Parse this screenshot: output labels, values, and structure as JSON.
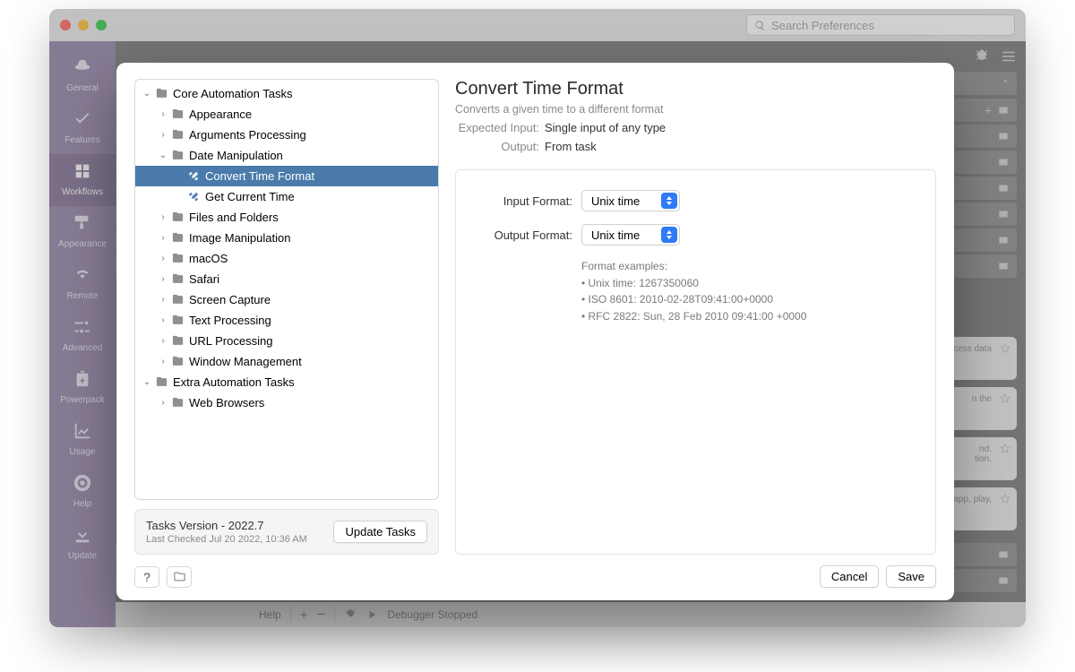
{
  "bg": {
    "search_placeholder": "Search Preferences",
    "sidebar": [
      {
        "label": "General",
        "icon": "hat"
      },
      {
        "label": "Features",
        "icon": "check"
      },
      {
        "label": "Workflows",
        "icon": "grid",
        "active": true
      },
      {
        "label": "Appearance",
        "icon": "roller"
      },
      {
        "label": "Remote",
        "icon": "remote"
      },
      {
        "label": "Advanced",
        "icon": "sliders"
      },
      {
        "label": "Powerpack",
        "icon": "battery"
      },
      {
        "label": "Usage",
        "icon": "chart"
      },
      {
        "label": "Help",
        "icon": "lifebuoy"
      },
      {
        "label": "Update",
        "icon": "download"
      }
    ],
    "card_snips": [
      "cess data",
      "n the",
      "nd.\ntion.",
      "app, play,"
    ],
    "footer": {
      "help": "Help",
      "plus": "+",
      "minus": "−",
      "debugger": "Debugger Stopped"
    }
  },
  "modal": {
    "tree": [
      {
        "depth": 0,
        "exp": "open",
        "icon": "folder",
        "label": "Core Automation Tasks"
      },
      {
        "depth": 1,
        "exp": "closed",
        "icon": "folder",
        "label": "Appearance"
      },
      {
        "depth": 1,
        "exp": "closed",
        "icon": "folder",
        "label": "Arguments Processing"
      },
      {
        "depth": 1,
        "exp": "open",
        "icon": "folder",
        "label": "Date Manipulation"
      },
      {
        "depth": 2,
        "exp": "none",
        "icon": "tool",
        "label": "Convert Time Format",
        "selected": true
      },
      {
        "depth": 2,
        "exp": "none",
        "icon": "tool",
        "label": "Get Current Time"
      },
      {
        "depth": 1,
        "exp": "closed",
        "icon": "folder",
        "label": "Files and Folders"
      },
      {
        "depth": 1,
        "exp": "closed",
        "icon": "folder",
        "label": "Image Manipulation"
      },
      {
        "depth": 1,
        "exp": "closed",
        "icon": "folder",
        "label": "macOS"
      },
      {
        "depth": 1,
        "exp": "closed",
        "icon": "folder",
        "label": "Safari"
      },
      {
        "depth": 1,
        "exp": "closed",
        "icon": "folder",
        "label": "Screen Capture"
      },
      {
        "depth": 1,
        "exp": "closed",
        "icon": "folder",
        "label": "Text Processing"
      },
      {
        "depth": 1,
        "exp": "closed",
        "icon": "folder",
        "label": "URL Processing"
      },
      {
        "depth": 1,
        "exp": "closed",
        "icon": "folder",
        "label": "Window Management"
      },
      {
        "depth": 0,
        "exp": "open",
        "icon": "folder",
        "label": "Extra Automation Tasks"
      },
      {
        "depth": 1,
        "exp": "closed",
        "icon": "folder",
        "label": "Web Browsers"
      }
    ],
    "version": {
      "title": "Tasks Version - 2022.7",
      "sub": "Last Checked Jul 20 2022, 10:36 AM",
      "button": "Update Tasks"
    },
    "detail": {
      "title": "Convert Time Format",
      "subtitle": "Converts a given time to a different format",
      "expected_input_label": "Expected Input:",
      "expected_input_value": "Single input of any type",
      "output_label": "Output:",
      "output_value": "From task",
      "input_format_label": "Input Format:",
      "input_format_value": "Unix time",
      "output_format_label": "Output Format:",
      "output_format_value": "Unix time",
      "examples_title": "Format examples:",
      "examples": [
        "• Unix time: 1267350060",
        "• ISO 8601: 2010-02-28T09:41:00+0000",
        "• RFC 2822: Sun, 28 Feb 2010 09:41:00 +0000"
      ]
    },
    "footer": {
      "help": "?",
      "cancel": "Cancel",
      "save": "Save"
    }
  }
}
